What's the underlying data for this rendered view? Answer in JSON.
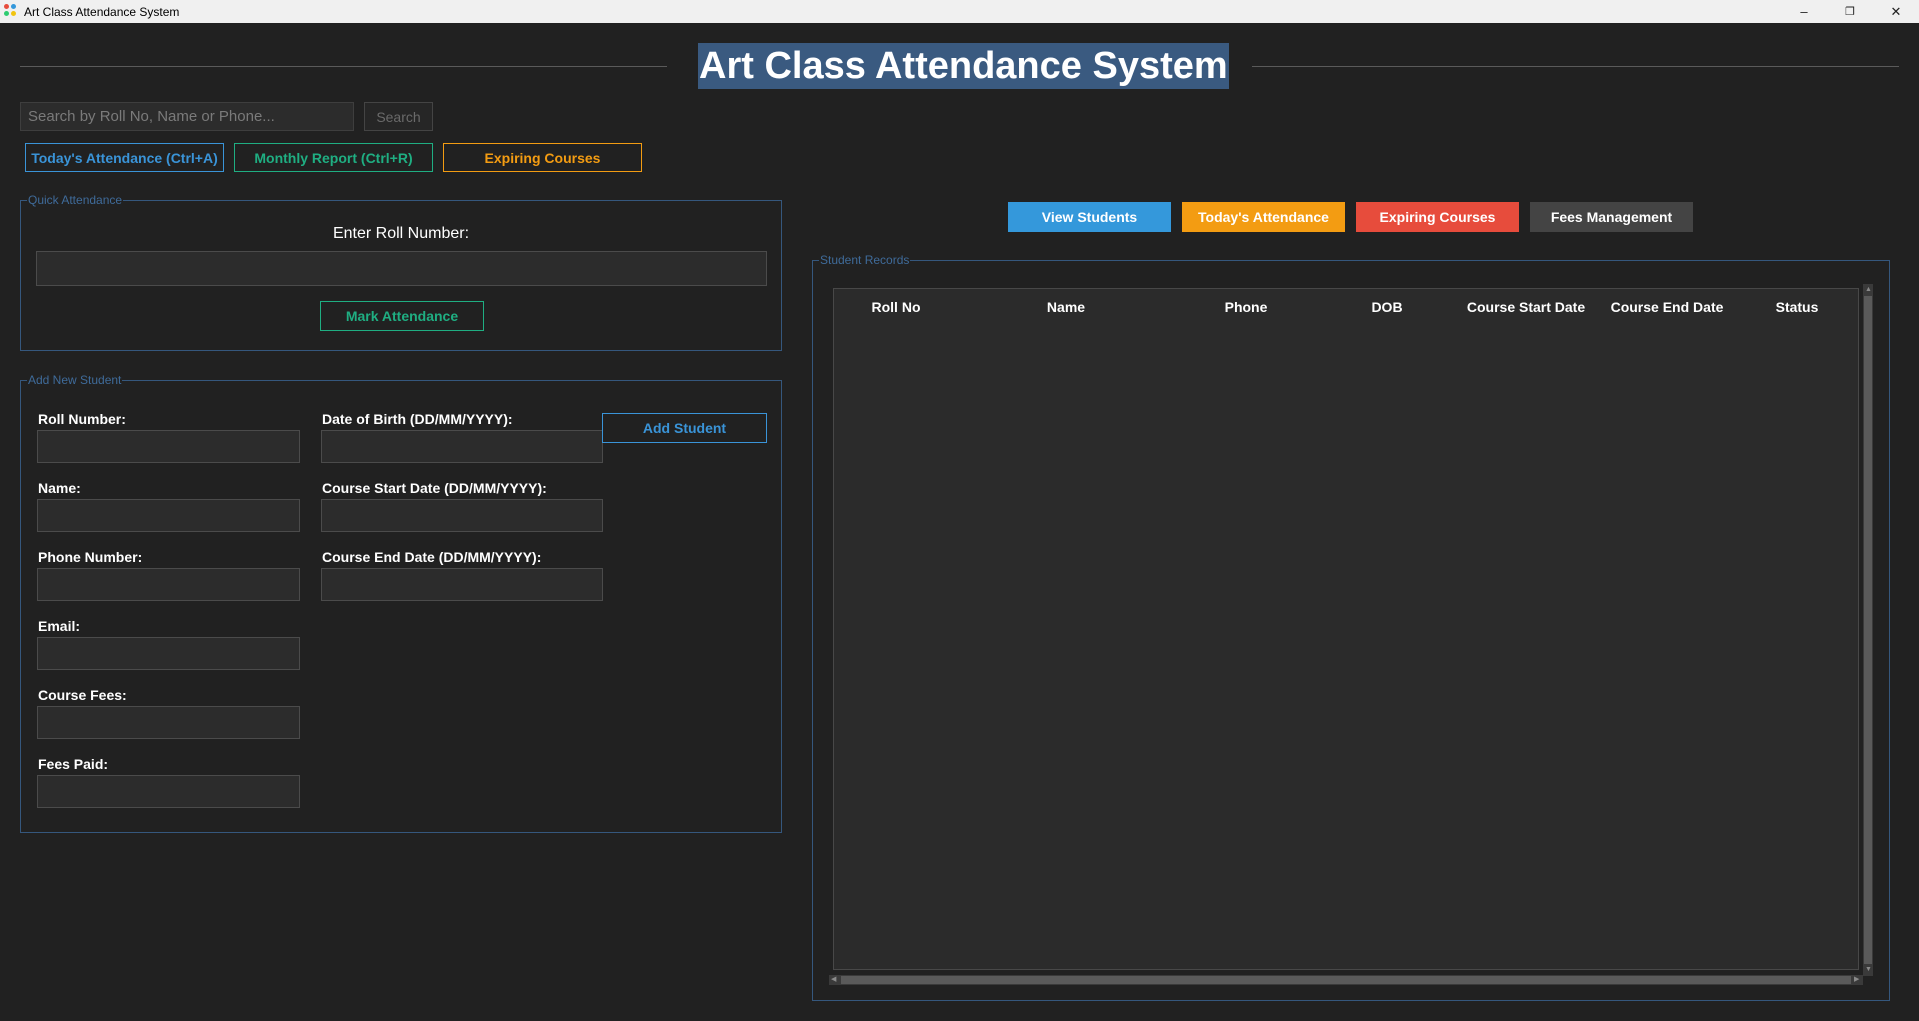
{
  "window": {
    "title": "Art Class Attendance System",
    "controls": {
      "minimize": "–",
      "restore": "❐",
      "close": "✕"
    }
  },
  "header": {
    "title": "Art Class Attendance System"
  },
  "search": {
    "placeholder": "Search by Roll No, Name or Phone...",
    "button_label": "Search"
  },
  "shortcuts": [
    {
      "label": "Today's Attendance (Ctrl+A)",
      "color": "#3a94d8"
    },
    {
      "label": "Monthly Report (Ctrl+R)",
      "color": "#1fae82"
    },
    {
      "label": "Expiring Courses",
      "color": "#f39c12"
    }
  ],
  "quick_attendance": {
    "legend": "Quick Attendance",
    "prompt": "Enter Roll Number:",
    "roll_value": "",
    "button_label": "Mark Attendance"
  },
  "add_student": {
    "legend": "Add New Student",
    "fields_left": [
      {
        "label": "Roll Number:",
        "value": ""
      },
      {
        "label": "Name:",
        "value": ""
      },
      {
        "label": "Phone Number:",
        "value": ""
      },
      {
        "label": "Email:",
        "value": ""
      },
      {
        "label": "Course Fees:",
        "value": ""
      },
      {
        "label": "Fees Paid:",
        "value": ""
      }
    ],
    "fields_right": [
      {
        "label": "Date of Birth (DD/MM/YYYY):",
        "value": ""
      },
      {
        "label": "Course Start Date (DD/MM/YYYY):",
        "value": ""
      },
      {
        "label": "Course End Date (DD/MM/YYYY):",
        "value": ""
      }
    ],
    "button_label": "Add Student"
  },
  "tabs": [
    {
      "label": "View Students",
      "color": "#3498db"
    },
    {
      "label": "Today's Attendance",
      "color": "#f39c12"
    },
    {
      "label": "Expiring Courses",
      "color": "#e74c3c"
    },
    {
      "label": "Fees Management",
      "color": "#444444"
    }
  ],
  "student_records": {
    "legend": "Student Records",
    "columns": [
      "Roll No",
      "Name",
      "Phone",
      "DOB",
      "Course Start Date",
      "Course End Date",
      "Status"
    ],
    "rows": []
  }
}
